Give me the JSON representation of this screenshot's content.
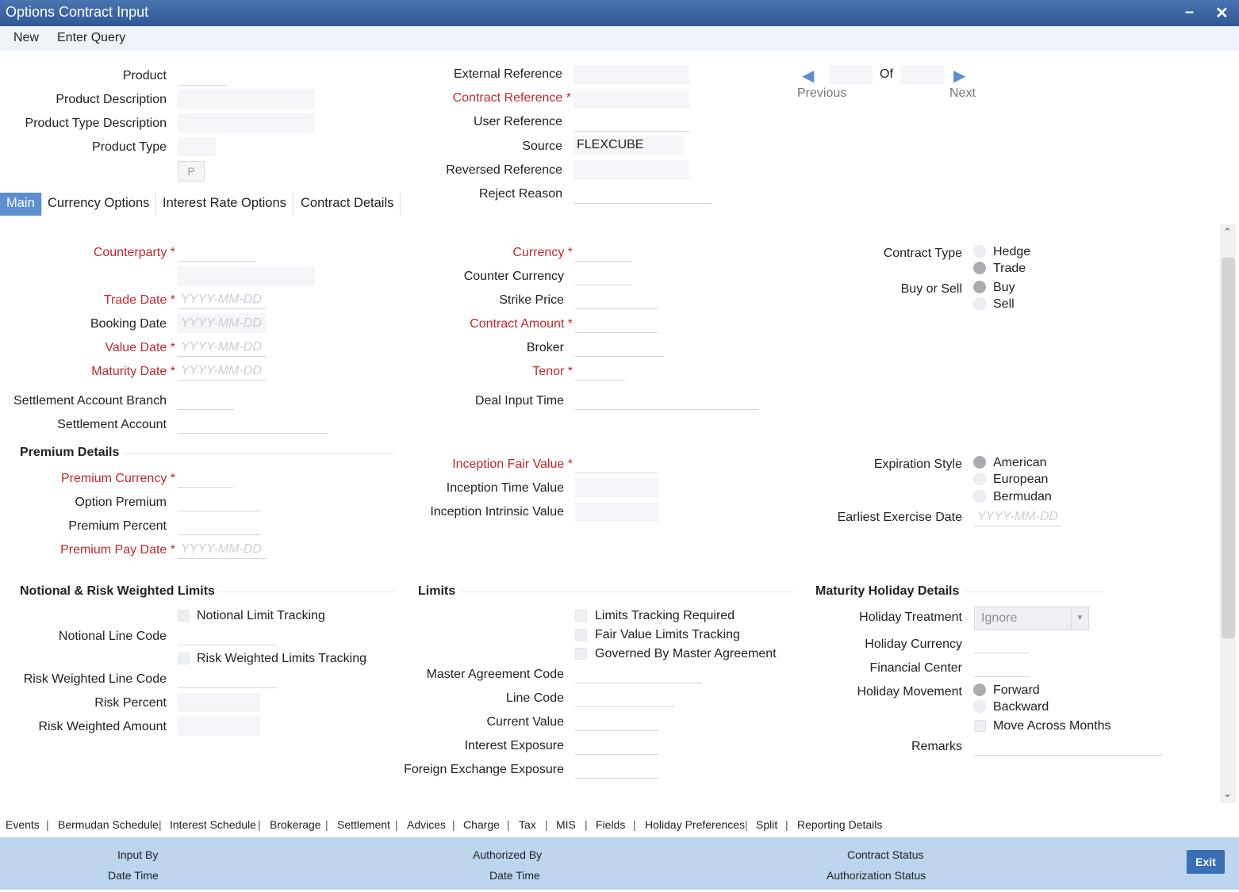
{
  "window": {
    "title": "Options Contract Input"
  },
  "menu": {
    "new": "New",
    "enter_query": "Enter Query"
  },
  "header": {
    "product": "Product",
    "product_description": "Product Description",
    "product_type_description": "Product Type Description",
    "product_type": "Product Type",
    "p_button": "P",
    "external_reference": "External Reference",
    "contract_reference": "Contract Reference",
    "user_reference": "User Reference",
    "source": "Source",
    "source_value": "FLEXCUBE",
    "reversed_reference": "Reversed Reference",
    "reject_reason": "Reject Reason"
  },
  "pager": {
    "previous": "Previous",
    "next": "Next",
    "of": "Of"
  },
  "tabs": [
    "Main",
    "Currency Options",
    "Interest Rate Options",
    "Contract Details"
  ],
  "main": {
    "counterparty": "Counterparty",
    "trade_date": "Trade Date",
    "booking_date": "Booking Date",
    "value_date": "Value Date",
    "maturity_date": "Maturity Date",
    "date_placeholder": "YYYY-MM-DD",
    "settlement_account_branch": "Settlement Account Branch",
    "settlement_account": "Settlement Account",
    "currency": "Currency",
    "counter_currency": "Counter Currency",
    "strike_price": "Strike Price",
    "contract_amount": "Contract Amount",
    "broker": "Broker",
    "tenor": "Tenor",
    "deal_input_time": "Deal Input Time",
    "contract_type": "Contract Type",
    "contract_type_options": [
      "Hedge",
      "Trade"
    ],
    "buy_or_sell": "Buy or Sell",
    "buy_or_sell_options": [
      "Buy",
      "Sell"
    ]
  },
  "premium": {
    "title": "Premium Details",
    "premium_currency": "Premium Currency",
    "option_premium": "Option Premium",
    "premium_percent": "Premium Percent",
    "premium_pay_date": "Premium Pay Date",
    "inception_fair_value": "Inception Fair Value",
    "inception_time_value": "Inception Time Value",
    "inception_intrinsic_value": "Inception Intrinsic Value",
    "expiration_style": "Expiration Style",
    "expiration_options": [
      "American",
      "European",
      "Bermudan"
    ],
    "earliest_exercise_date": "Earliest Exercise Date"
  },
  "notional": {
    "title": "Notional & Risk Weighted Limits",
    "notional_limit_tracking": "Notional Limit Tracking",
    "notional_line_code": "Notional Line Code",
    "risk_weighted_limits_tracking": "Risk Weighted Limits Tracking",
    "risk_weighted_line_code": "Risk Weighted Line Code",
    "risk_percent": "Risk Percent",
    "risk_weighted_amount": "Risk Weighted Amount"
  },
  "limits": {
    "title": "Limits",
    "limits_tracking_required": "Limits Tracking Required",
    "fair_value_limits_tracking": "Fair Value Limits Tracking",
    "governed_by_master_agreement": "Governed By Master Agreement",
    "master_agreement_code": "Master Agreement Code",
    "line_code": "Line Code",
    "current_value": "Current Value",
    "interest_exposure": "Interest Exposure",
    "foreign_exchange_exposure": "Foreign Exchange Exposure"
  },
  "holiday": {
    "title": "Maturity Holiday Details",
    "holiday_treatment": "Holiday Treatment",
    "holiday_treatment_value": "Ignore",
    "holiday_currency": "Holiday Currency",
    "financial_center": "Financial Center",
    "holiday_movement": "Holiday Movement",
    "movement_options": [
      "Forward",
      "Backward"
    ],
    "move_across_months": "Move Across Months",
    "remarks": "Remarks"
  },
  "bottom_links": [
    "Events",
    "Bermudan Schedule",
    "Interest Schedule",
    "Brokerage",
    "Settlement",
    "Advices",
    "Charge",
    "Tax",
    "MIS",
    "Fields",
    "Holiday Preferences",
    "Split",
    "Reporting Details"
  ],
  "footer": {
    "input_by": "Input By",
    "date_time": "Date Time",
    "authorized_by": "Authorized By",
    "contract_status": "Contract Status",
    "authorization_status": "Authorization Status",
    "exit": "Exit"
  }
}
